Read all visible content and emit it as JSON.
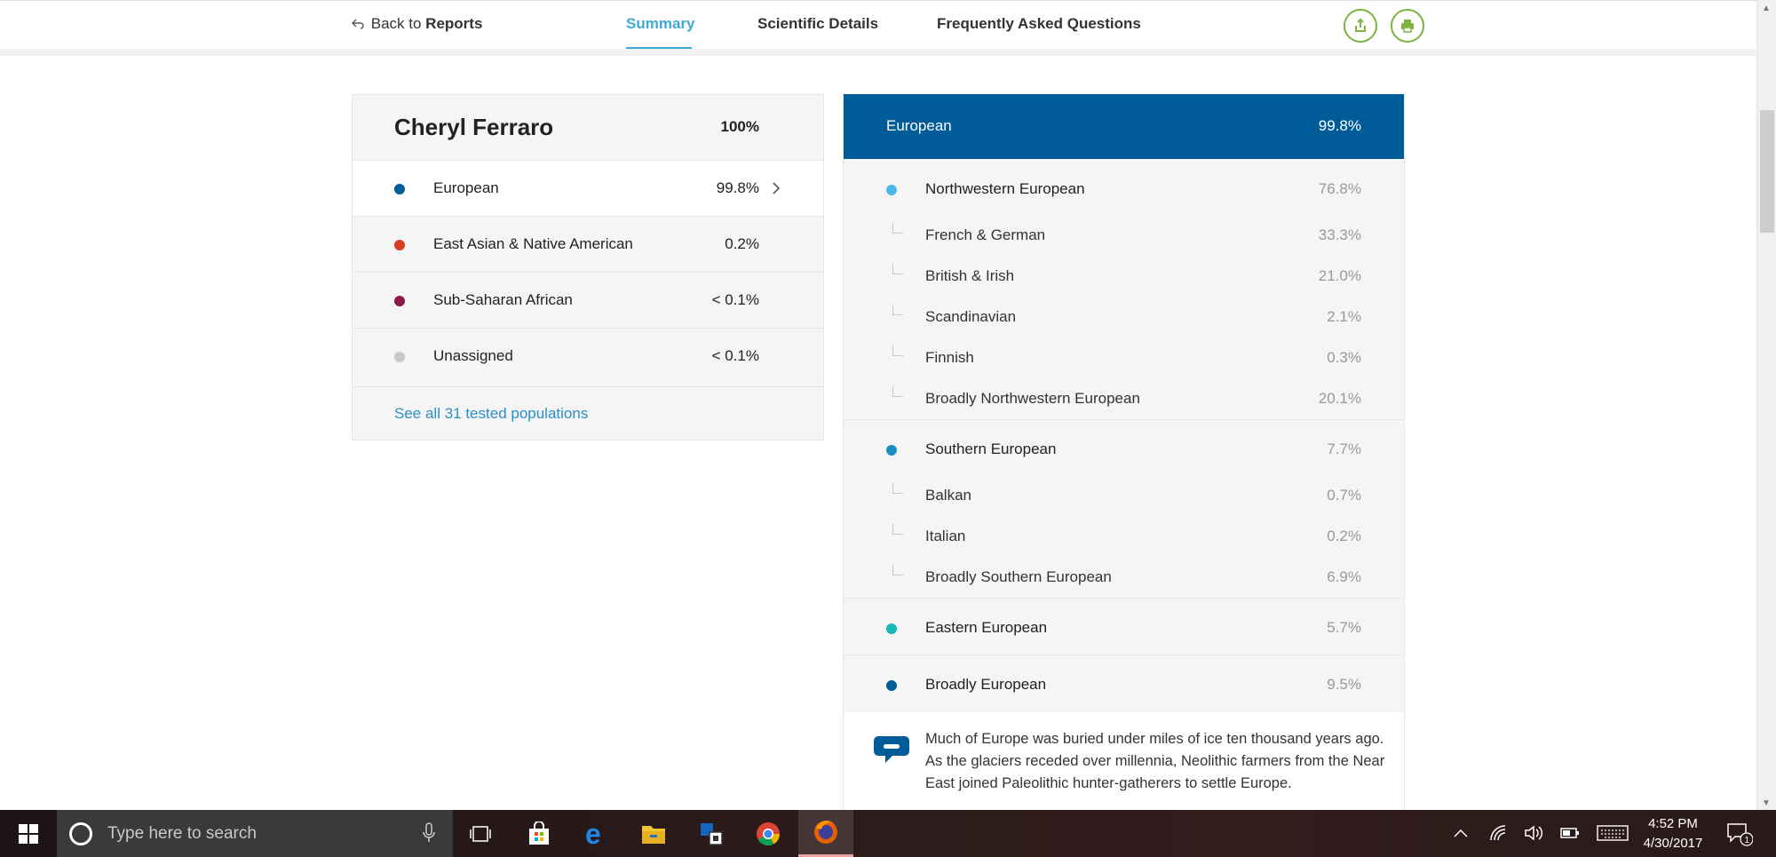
{
  "nav": {
    "back_prefix": "Back to",
    "back_bold": "Reports",
    "tabs": [
      {
        "label": "Summary",
        "active": true
      },
      {
        "label": "Scientific Details",
        "active": false
      },
      {
        "label": "Frequently Asked Questions",
        "active": false
      }
    ],
    "share_icon": "share-icon",
    "print_icon": "print-icon",
    "accent_color": "#3fa9d6",
    "button_color": "#7cb342"
  },
  "summary": {
    "name": "Cheryl Ferraro",
    "total": "100%",
    "rows": [
      {
        "label": "European",
        "value": "99.8%",
        "color": "#005b99",
        "selected": true
      },
      {
        "label": "East Asian & Native American",
        "value": "0.2%",
        "color": "#d2401d",
        "selected": false
      },
      {
        "label": "Sub-Saharan African",
        "value": "< 0.1%",
        "color": "#8a1a4a",
        "selected": false
      },
      {
        "label": "Unassigned",
        "value": "< 0.1%",
        "color": "#c8c8c8",
        "selected": false
      }
    ],
    "link": "See all 31 tested populations"
  },
  "detail": {
    "header_label": "European",
    "header_value": "99.8%",
    "header_color": "#005b99",
    "groups": [
      {
        "label": "Northwestern European",
        "value": "76.8%",
        "color": "#4fb8e8",
        "subs": [
          {
            "label": "French & German",
            "value": "33.3%"
          },
          {
            "label": "British & Irish",
            "value": "21.0%"
          },
          {
            "label": "Scandinavian",
            "value": "2.1%"
          },
          {
            "label": "Finnish",
            "value": "0.3%"
          },
          {
            "label": "Broadly Northwestern European",
            "value": "20.1%"
          }
        ]
      },
      {
        "label": "Southern European",
        "value": "7.7%",
        "color": "#1a8ec1",
        "subs": [
          {
            "label": "Balkan",
            "value": "0.7%"
          },
          {
            "label": "Italian",
            "value": "0.2%"
          },
          {
            "label": "Broadly Southern European",
            "value": "6.9%"
          }
        ]
      },
      {
        "label": "Eastern European",
        "value": "5.7%",
        "color": "#1ab5b5",
        "subs": []
      },
      {
        "label": "Broadly European",
        "value": "9.5%",
        "color": "#005b99",
        "subs": []
      }
    ],
    "fact": "Much of Europe was buried under miles of ice ten thousand years ago. As the glaciers receded over millennia, Neolithic farmers from the Near East joined Paleolithic hunter-gatherers to settle Europe.",
    "fact_icon": "speech-bubble-icon"
  },
  "taskbar": {
    "search_placeholder": "Type here to search",
    "apps": [
      "task-view-icon",
      "store-icon",
      "edge-icon",
      "file-explorer-icon",
      "app-icon",
      "chrome-icon",
      "firefox-icon"
    ],
    "active_app": "firefox-icon",
    "time": "4:52 PM",
    "date": "4/30/2017",
    "notification_count": "1"
  }
}
